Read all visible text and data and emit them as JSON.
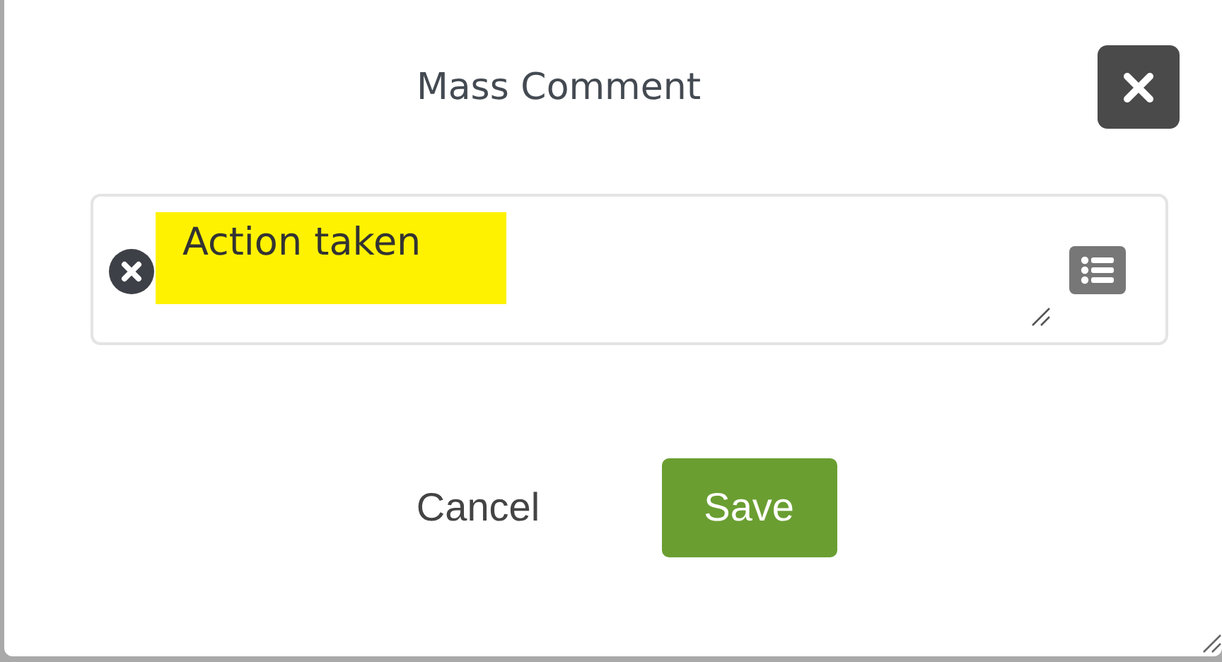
{
  "dialog": {
    "title": "Mass Comment"
  },
  "comment": {
    "value": "Action taken",
    "highlighted": true
  },
  "buttons": [
    {
      "label": "Cancel",
      "kind": "link"
    },
    {
      "label": "Save",
      "kind": "primary"
    }
  ]
}
